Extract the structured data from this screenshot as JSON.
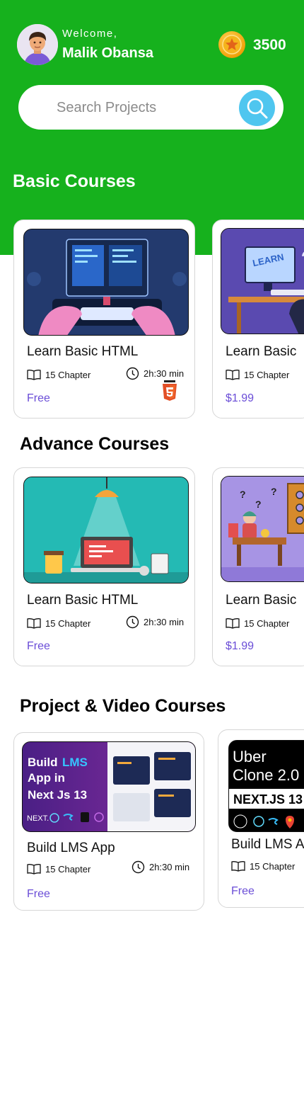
{
  "header": {
    "welcome": "Welcome,",
    "user_name": "Malik Obansa",
    "coins": "3500"
  },
  "search": {
    "placeholder": "Search Projects"
  },
  "sections": {
    "basic": "Basic Courses",
    "advance": "Advance Courses",
    "project": "Project & Video Courses"
  },
  "basic_courses": [
    {
      "title": "Learn  Basic HTML",
      "chapters": "15 Chapter",
      "duration": "2h:30 min",
      "price": "Free"
    },
    {
      "title": "Learn  Basic",
      "chapters": "15 Chapter",
      "price": "$1.99"
    }
  ],
  "advance_courses": [
    {
      "title": "Learn  Basic HTML",
      "chapters": "15 Chapter",
      "duration": "2h:30 min",
      "price": "Free"
    },
    {
      "title": "Learn  Basic",
      "chapters": "15 Chapter",
      "price": "$1.99"
    }
  ],
  "project_courses": [
    {
      "title": "Build LMS App",
      "chapters": "15 Chapter",
      "duration": "2h:30 min",
      "price": "Free",
      "banner": {
        "line1": "Build",
        "accent": "LMS",
        "line2": "App in",
        "line3": "Next Js 13",
        "brand": "NEXT."
      }
    },
    {
      "title": "Build LMS A",
      "chapters": "15 Chapter",
      "price": "Free",
      "banner": {
        "line1": "Uber",
        "line2": "Clone 2.0",
        "line3": "NEXT.JS 13"
      }
    }
  ],
  "colors": {
    "brand_green": "#16b11d",
    "price_purple": "#6a4dd7",
    "search_blue": "#4fc6ef"
  }
}
